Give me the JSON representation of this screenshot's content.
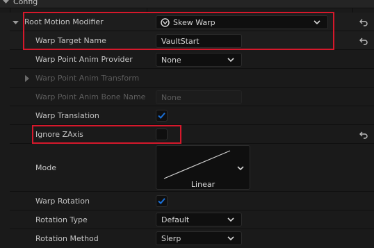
{
  "header": {
    "category": "Config"
  },
  "rows": {
    "root_motion_modifier": {
      "label": "Root Motion Modifier",
      "value": "Skew Warp"
    },
    "warp_target_name": {
      "label": "Warp Target Name",
      "value": "VaultStart"
    },
    "warp_point_anim_provider": {
      "label": "Warp Point Anim Provider",
      "value": "None"
    },
    "warp_point_anim_transform": {
      "label": "Warp Point Anim Transform"
    },
    "warp_point_anim_bone_name": {
      "label": "Warp Point Anim Bone Name",
      "value": "None"
    },
    "warp_translation": {
      "label": "Warp Translation",
      "checked": true
    },
    "ignore_zaxis": {
      "label": "Ignore ZAxis",
      "checked": false
    },
    "mode": {
      "label": "Mode",
      "value": "Linear"
    },
    "warp_rotation": {
      "label": "Warp Rotation",
      "checked": true
    },
    "rotation_type": {
      "label": "Rotation Type",
      "value": "Default"
    },
    "rotation_method": {
      "label": "Rotation Method",
      "value": "Slerp"
    }
  },
  "colors": {
    "accent": "#1a6fd6",
    "highlight_box": "#d6182b",
    "panel": "#1a1a1a",
    "field": "#0f0f0f"
  }
}
